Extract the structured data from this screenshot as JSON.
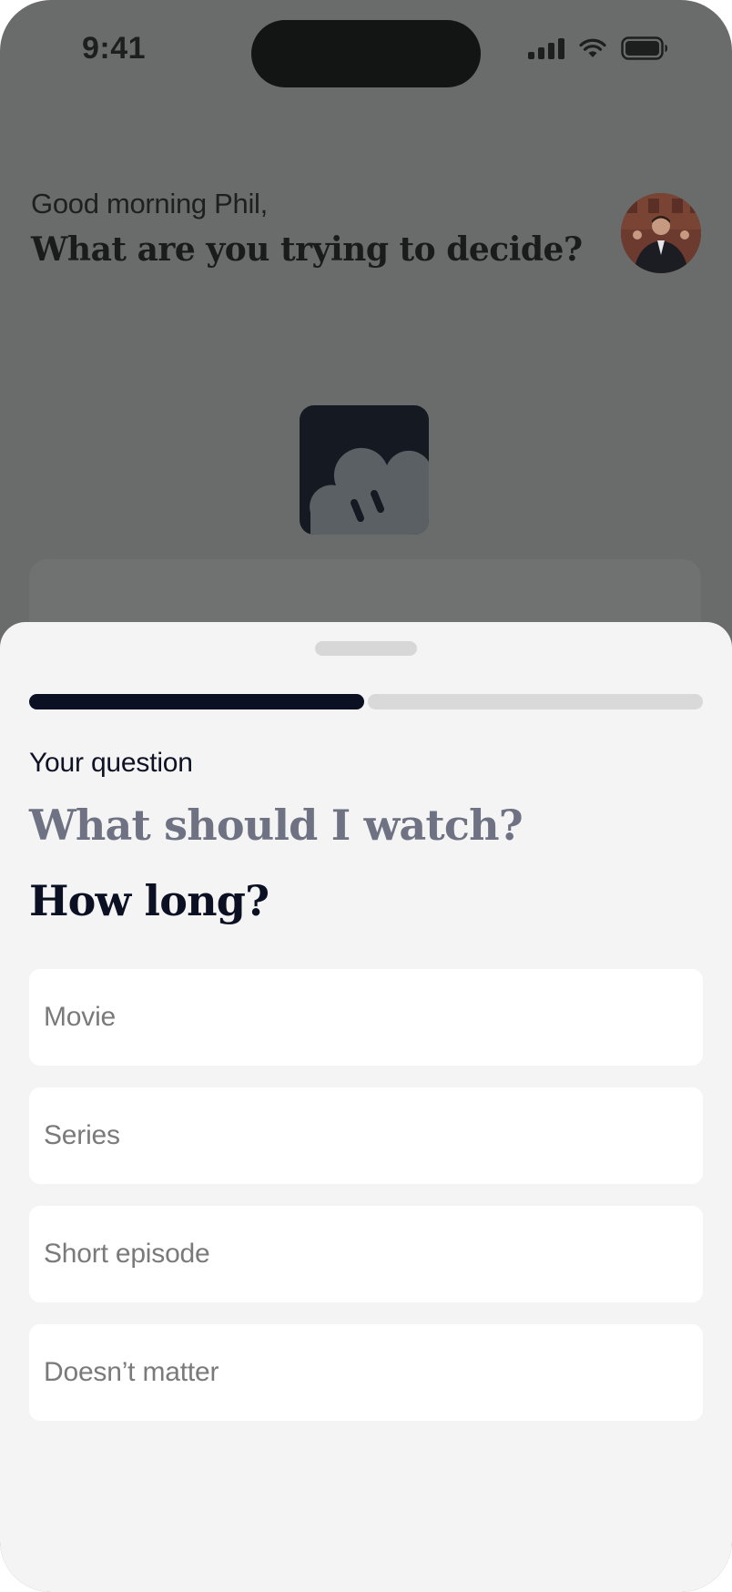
{
  "status_bar": {
    "time": "9:41",
    "icons": [
      "cellular-signal-icon",
      "wifi-icon",
      "battery-icon"
    ]
  },
  "header": {
    "greeting": "Good morning Phil,",
    "prompt": "What are you trying to decide?"
  },
  "sheet": {
    "progress": 0.5,
    "question_label": "Your question",
    "question": "What should I watch?",
    "sub_question": "How long?",
    "options": [
      {
        "label": "Movie"
      },
      {
        "label": "Series"
      },
      {
        "label": "Short episode"
      },
      {
        "label": "Doesn’t matter"
      }
    ]
  },
  "colors": {
    "accent": "#0c1023",
    "overlay": "#6a6b6b",
    "sheet_background": "#f4f4f4",
    "muted_text": "#6e7282"
  }
}
